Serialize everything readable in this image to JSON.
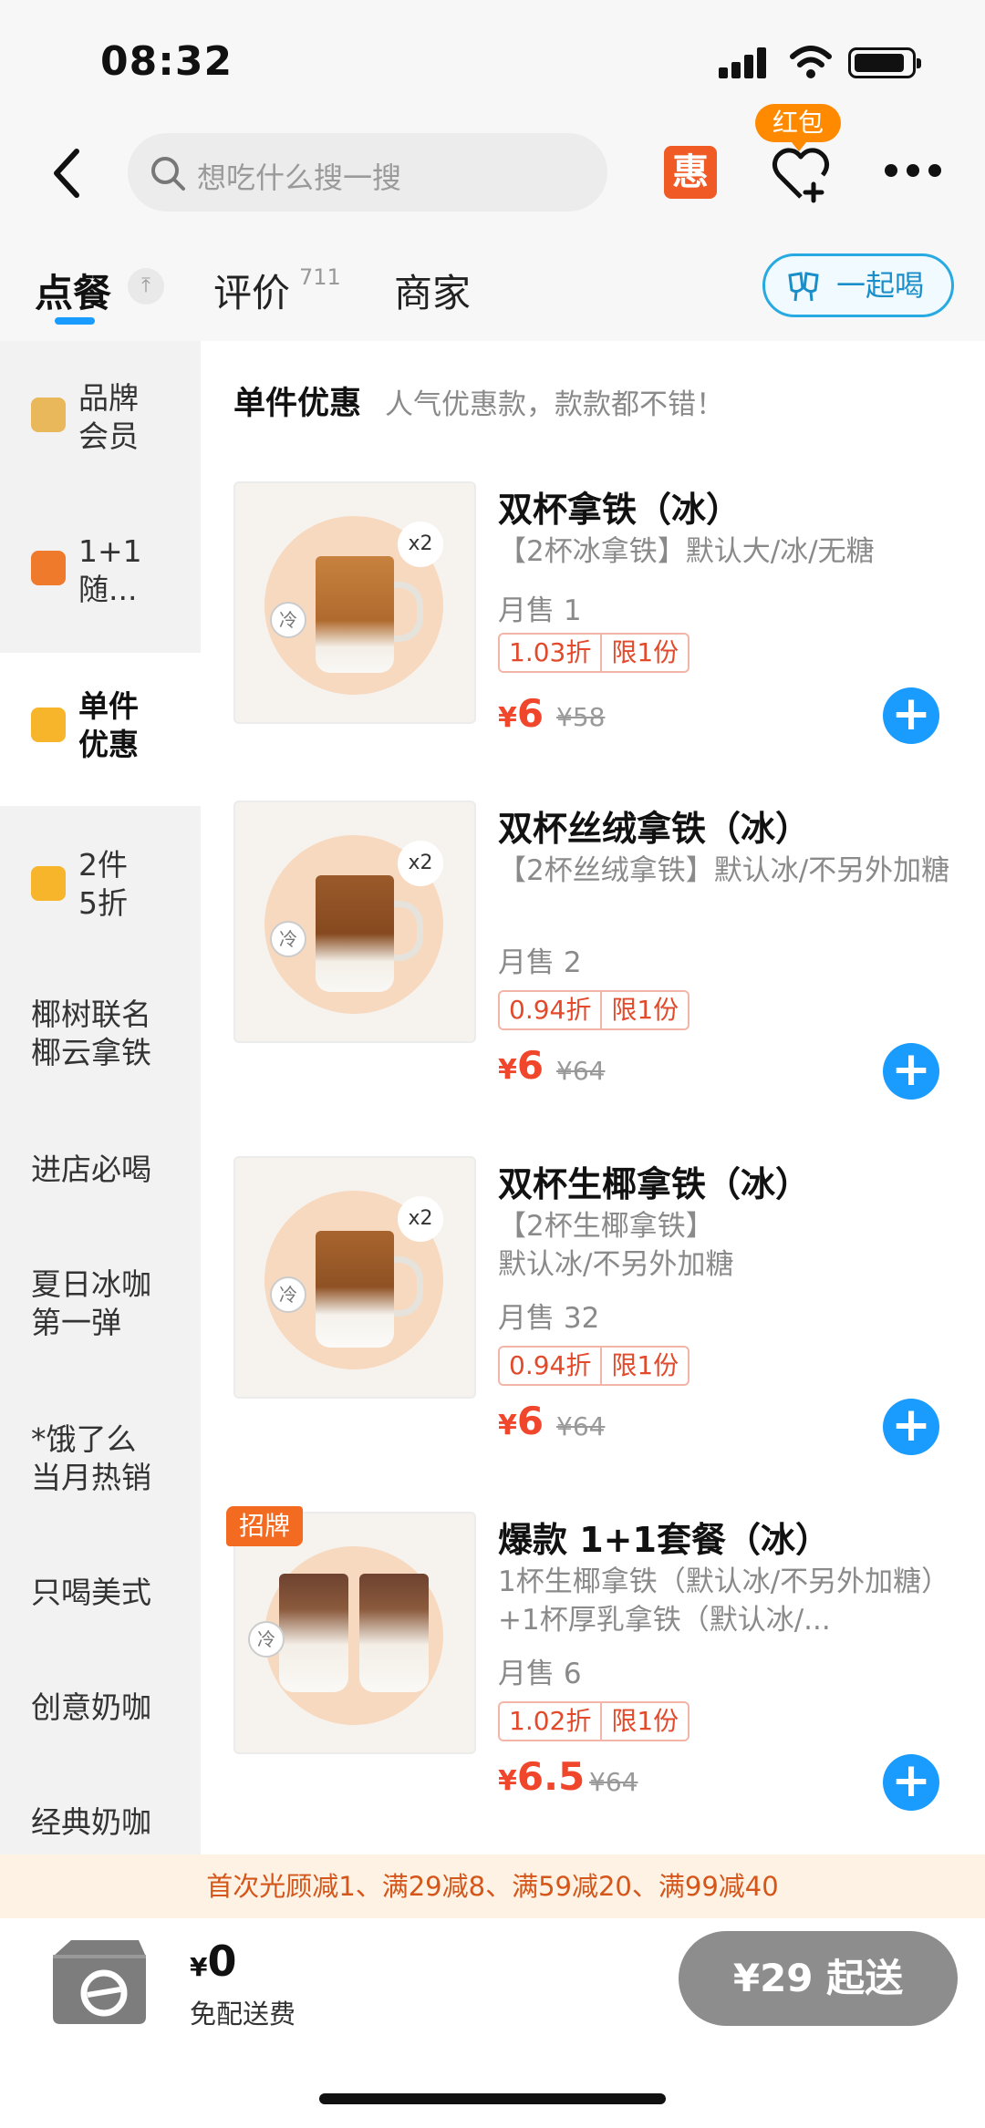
{
  "status_bar": {
    "time": "08:32"
  },
  "nav": {
    "search_placeholder": "想吃什么搜一搜",
    "hui_label": "惠",
    "hongbao_label": "红包"
  },
  "tabs": {
    "order": "点餐",
    "pin": "⤒",
    "review": "评价",
    "review_count": "711",
    "merchant": "商家",
    "together": "一起喝"
  },
  "sidebar": {
    "items": [
      {
        "label": "品牌\n会员",
        "icon": "member-icon",
        "color": "#e8b85a"
      },
      {
        "label": "1+1\n随...",
        "icon": "gift-icon",
        "color": "#f07a2b"
      },
      {
        "label": "单件\n优惠",
        "icon": "tag-icon",
        "color": "#f6b52a",
        "active": true
      },
      {
        "label": "2件\n5折",
        "icon": "tag-icon",
        "color": "#f6b52a"
      },
      {
        "label": "椰树联名\n椰云拿铁"
      },
      {
        "label": "进店必喝"
      },
      {
        "label": "夏日冰咖\n第一弹"
      },
      {
        "label": "*饿了么\n当月热销"
      },
      {
        "label": "只喝美式"
      },
      {
        "label": "创意奶咖"
      },
      {
        "label": "经典奶咖"
      }
    ]
  },
  "section": {
    "title": "单件优惠",
    "subtitle": "人气优惠款，款款都不错！"
  },
  "products": [
    {
      "name": "双杯拿铁（冰）",
      "desc": "【2杯冰拿铁】默认大/冰/无糖",
      "sales": "月售 1",
      "discount": "1.03折",
      "limit": "限1份",
      "currency": "¥",
      "price": "6",
      "orig": "¥58",
      "multi": "x2",
      "cold": "冷"
    },
    {
      "name": "双杯丝绒拿铁（冰）",
      "desc": "【2杯丝绒拿铁】默认冰/不另外加糖",
      "sales": "月售 2",
      "discount": "0.94折",
      "limit": "限1份",
      "currency": "¥",
      "price": "6",
      "orig": "¥64",
      "multi": "x2",
      "cold": "冷"
    },
    {
      "name": "双杯生椰拿铁（冰）",
      "desc": "【2杯生椰拿铁】\n默认冰/不另外加糖",
      "sales": "月售 32",
      "discount": "0.94折",
      "limit": "限1份",
      "currency": "¥",
      "price": "6",
      "orig": "¥64",
      "multi": "x2",
      "cold": "冷"
    },
    {
      "name": "爆款 1+1套餐（冰）",
      "desc": "1杯生椰拿铁（默认冰/不另外加糖）+1杯厚乳拿铁（默认冰/...",
      "sales": "月售 6",
      "discount": "1.02折",
      "limit": "限1份",
      "currency": "¥",
      "price": "6.5",
      "orig": "¥64",
      "badge": "招牌",
      "cold": "冷"
    }
  ],
  "promo": "首次光顾减1、满29减8、满59减20、满99减40",
  "cart": {
    "currency": "¥",
    "amount": "0",
    "fee": "免配送费",
    "checkout": "¥29 起送"
  },
  "colors": {
    "accent": "#1a9cff",
    "price": "#f0462b",
    "promo_text": "#d4561a"
  }
}
